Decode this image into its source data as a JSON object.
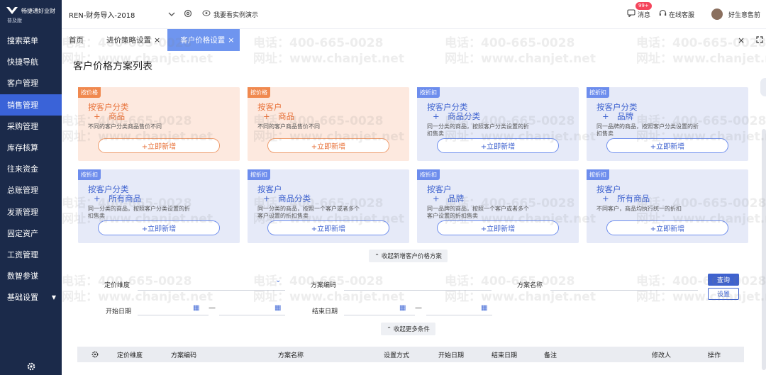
{
  "app": {
    "logo_text": "畅捷通好业财",
    "logo_sub": "普及版"
  },
  "sidebar": {
    "items": [
      {
        "label": "搜索菜单"
      },
      {
        "label": "快捷导航"
      },
      {
        "label": "客户管理"
      },
      {
        "label": "销售管理"
      },
      {
        "label": "采购管理"
      },
      {
        "label": "库存核算"
      },
      {
        "label": "往来资金"
      },
      {
        "label": "总账管理"
      },
      {
        "label": "发票管理"
      },
      {
        "label": "固定资产"
      },
      {
        "label": "工资管理"
      },
      {
        "label": "数智参谋"
      },
      {
        "label": "基础设置"
      }
    ],
    "active_index": 3
  },
  "topbar": {
    "account": "REN-财务导入-2018",
    "demo_link": "我要看实例演示",
    "messages": "消息",
    "messages_badge": "99+",
    "service": "在线客服",
    "user": "好生意售前"
  },
  "tabs": [
    {
      "label": "首页"
    },
    {
      "label": "进价策略设置"
    },
    {
      "label": "客户价格设置"
    }
  ],
  "page": {
    "title": "客户价格方案列表"
  },
  "cards": [
    {
      "tag": "按价格",
      "line1": "按客户分类",
      "line2": "+　商品",
      "desc": "不同的客户分类商品售价不同",
      "button": "+立即新增"
    },
    {
      "tag": "按价格",
      "line1": "按客户",
      "line2": "+　商品",
      "desc": "不同的客户商品售价不同",
      "button": "+立即新增"
    },
    {
      "tag": "按折扣",
      "line1": "按客户分类",
      "line2": "+　商品分类",
      "desc": "同一分类的商品，按照客户分类设置的折扣售卖",
      "button": "+立即新增"
    },
    {
      "tag": "按折扣",
      "line1": "按客户分类",
      "line2": "+　品牌",
      "desc": "同一品牌的商品，按照客户分类设置的折扣售卖",
      "button": "+立即新增"
    },
    {
      "tag": "按折扣",
      "line1": "按客户分类",
      "line2": "+　所有商品",
      "desc": "同一分类的商品，按照客户分类设置的折扣售卖",
      "button": "+立即新增"
    },
    {
      "tag": "按折扣",
      "line1": "按客户",
      "line2": "+　商品分类",
      "desc": "同一分类的商品，按照一个客户或者多个客户设置的折扣售卖",
      "button": "+立即新增"
    },
    {
      "tag": "按折扣",
      "line1": "按客户",
      "line2": "+　品牌",
      "desc": "同一品牌的商品，按照一个客户或者多个客户设置的折扣售卖",
      "button": "+立即新增"
    },
    {
      "tag": "按折扣",
      "line1": "按客户",
      "line2": "+　所有商品",
      "desc": "不同客户，商品均执行统一的折扣",
      "button": "+立即新增"
    }
  ],
  "collapse_cards": "收起新增客户价格方案",
  "filters": {
    "price_dimension": "定价维度",
    "scheme_code": "方案编码",
    "scheme_name": "方案名称",
    "start_date": "开始日期",
    "end_date": "结束日期",
    "dash": "—",
    "query_button": "查询",
    "settings_button": "设置",
    "collapse_more": "收起更多条件"
  },
  "table": {
    "columns": [
      "定价维度",
      "方案编码",
      "方案名称",
      "设置方式",
      "开始日期",
      "结束日期",
      "备注",
      "修改人",
      "操作"
    ]
  },
  "watermark": {
    "phone": "电话：400-665-0028",
    "site": "网址：www.chanjet.net"
  },
  "colors": {
    "sidebar_bg": "#1b2a4a",
    "active_nav": "#3a63d8",
    "primary": "#3e62cf",
    "orange": "#e8723a"
  }
}
